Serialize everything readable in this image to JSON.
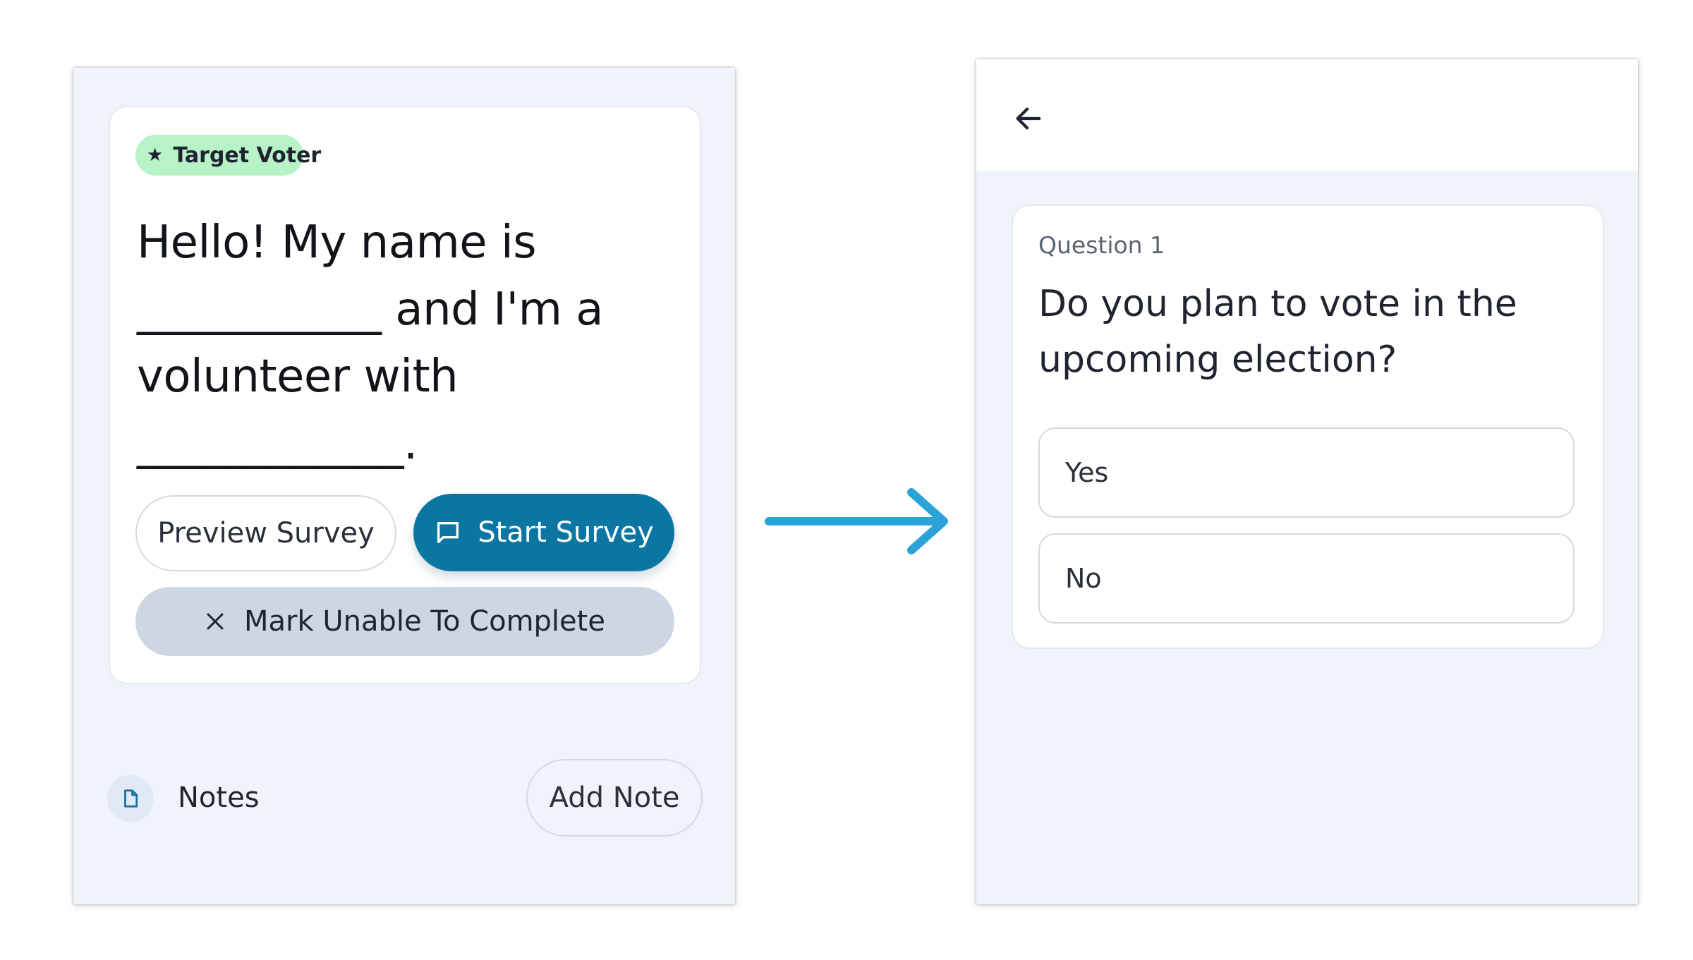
{
  "left_screen": {
    "badge": {
      "icon": "star-icon",
      "label": "Target Voter"
    },
    "script_text": "Hello! My name is\n___________ and I'm a\nvolunteer with\n____________.",
    "buttons": {
      "preview_survey": "Preview Survey",
      "start_survey": "Start Survey",
      "mark_unable": "Mark Unable To Complete"
    },
    "notes": {
      "icon": "document-icon",
      "label": "Notes",
      "add_note": "Add Note"
    }
  },
  "right_screen": {
    "back_icon": "arrow-left-icon",
    "question": {
      "number_label": "Question 1",
      "text": "Do you plan to vote in the upcoming election?",
      "options": [
        "Yes",
        "No"
      ]
    }
  },
  "colors": {
    "screen_background": "#f0f3fa",
    "badge_green": "#b8f3c8",
    "primary_button": "#0a76a1",
    "secondary_button": "#cdd6e3",
    "flow_arrow": "#2ba3d9"
  }
}
